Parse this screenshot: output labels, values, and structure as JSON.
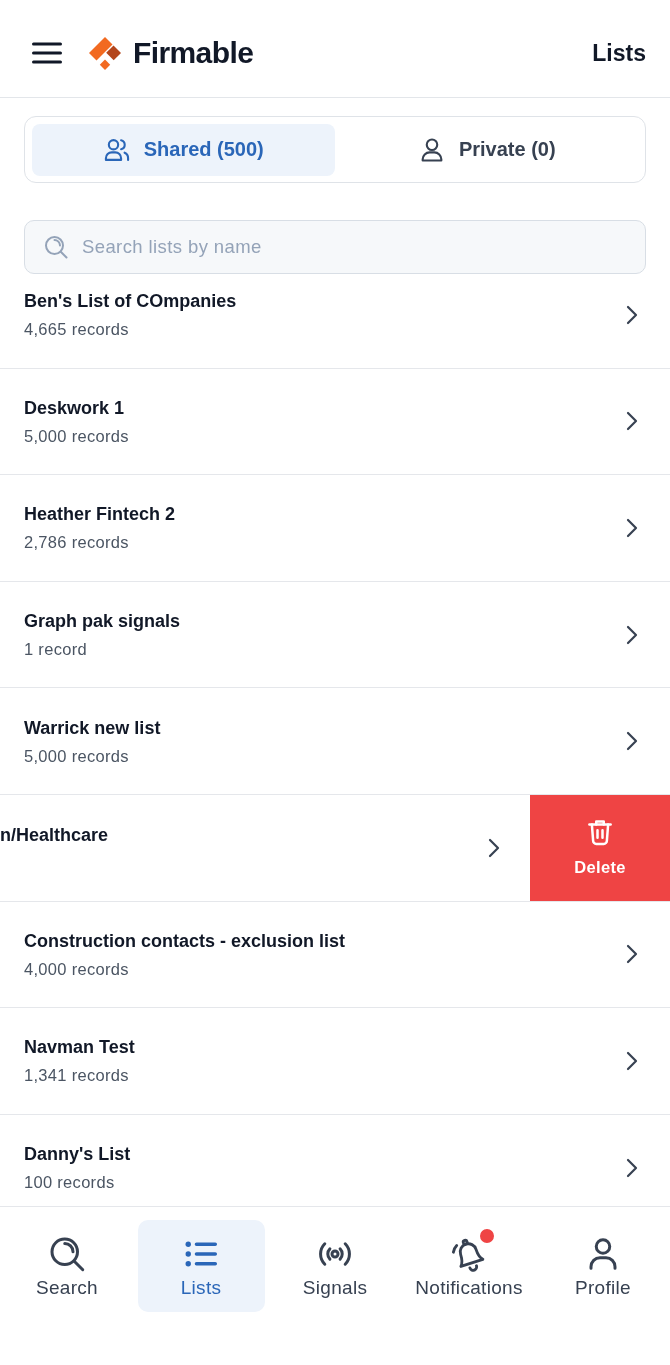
{
  "header": {
    "brand": "Firmable",
    "title": "Lists"
  },
  "tabs": [
    {
      "label": "Shared (500)",
      "kind": "group",
      "selected": true
    },
    {
      "label": "Private (0)",
      "kind": "single",
      "selected": false
    }
  ],
  "search": {
    "placeholder": "Search lists by name"
  },
  "lists": [
    {
      "kind": "row",
      "title": "Ben's List of COmpanies",
      "records": "4,665 records"
    },
    {
      "kind": "row",
      "title": "Deskwork 1",
      "records": "5,000 records"
    },
    {
      "kind": "row",
      "title": "Heather Fintech 2",
      "records": "2,786 records"
    },
    {
      "kind": "row",
      "title": "Graph pak signals",
      "records": "1 record"
    },
    {
      "kind": "row",
      "title": "Warrick new list",
      "records": "5,000 records"
    },
    {
      "kind": "swiped",
      "title": "n/Healthcare",
      "action": "Delete"
    },
    {
      "kind": "row",
      "title": "Construction contacts - exclusion list",
      "records": "4,000 records"
    },
    {
      "kind": "row",
      "title": "Navman Test",
      "records": "1,341 records"
    },
    {
      "kind": "row",
      "title": "Danny's List",
      "records": "100 records"
    }
  ],
  "bottom_nav": [
    {
      "label": "Search",
      "kind": "search",
      "selected": false,
      "badge": false
    },
    {
      "label": "Lists",
      "kind": "lists",
      "selected": true,
      "badge": false
    },
    {
      "label": "Signals",
      "kind": "signals",
      "selected": false,
      "badge": false
    },
    {
      "label": "Notifications",
      "kind": "notifications",
      "selected": false,
      "badge": true
    },
    {
      "label": "Profile",
      "kind": "profile",
      "selected": false,
      "badge": false
    }
  ]
}
